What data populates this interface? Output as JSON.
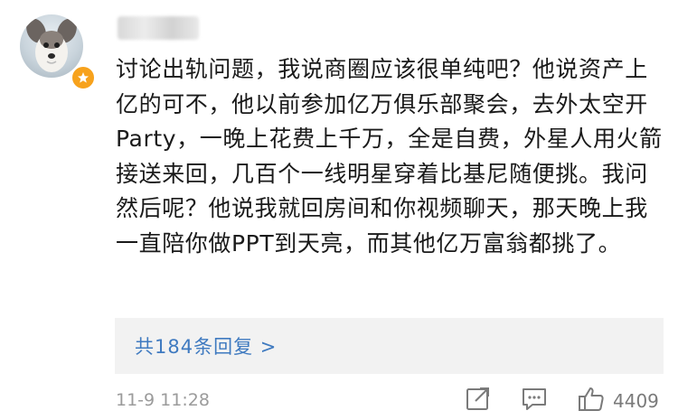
{
  "comment": {
    "text": "讨论出轨问题，我说商圈应该很单纯吧？他说资产上亿的可不，他以前参加亿万俱乐部聚会，去外太空开Party，一晚上花费上千万，全是自费，外星人用火箭接送来回，几百个一线明星穿着比基尼随便挑。我问然后呢？他说我就回房间和你视频聊天，那天晚上我一直陪你做PPT到天亮，而其他亿万富翁都挑了。"
  },
  "replies": {
    "label": "共184条回复 >"
  },
  "meta": {
    "timestamp": "11-9 11:28",
    "like_count": "4409"
  },
  "icons": {
    "share": "share-icon",
    "comment": "comment-icon",
    "like": "thumbs-up-icon",
    "verified": "verified-badge-icon"
  },
  "colors": {
    "link": "#3f7ac0",
    "badge": "#f7a21c",
    "muted": "#9b9b9b",
    "reply_bg": "#f2f2f2"
  }
}
